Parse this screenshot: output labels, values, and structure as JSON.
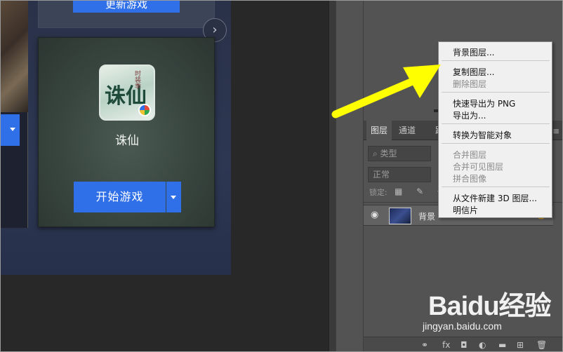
{
  "game_card": {
    "top_button_label": "更新游戏",
    "game_name": "诛仙",
    "icon_text": "诛仙",
    "icon_tag": "时装季",
    "play_button": "开始游戏",
    "next_arrow": "›"
  },
  "layers_panel": {
    "tabs": [
      "图层",
      "通道",
      "路"
    ],
    "active_tab": "图层",
    "filter_label": "类型",
    "blend_mode": "正常",
    "lock_label": "锁定:",
    "lock_icons": "▦ ✎ ✥",
    "layer": {
      "name": "背景",
      "eye": "◉",
      "lock_icon": "🔒"
    },
    "bottom_icons": [
      "⚭",
      "fx",
      "◘",
      "◐",
      "▬",
      "⊞",
      "🗑"
    ],
    "panel_menu_icon": "≡"
  },
  "context_menu": {
    "items": [
      {
        "label": "背景图层...",
        "enabled": true
      },
      {
        "label": "复制图层...",
        "enabled": true
      },
      {
        "label": "删除图层",
        "enabled": false
      },
      {
        "label": "快速导出为 PNG",
        "enabled": true
      },
      {
        "label": "导出为...",
        "enabled": true
      },
      {
        "label": "转换为智能对象",
        "enabled": true
      },
      {
        "label": "合并图层",
        "enabled": false
      },
      {
        "label": "合并可见图层",
        "enabled": false
      },
      {
        "label": "拼合图像",
        "enabled": false
      },
      {
        "label": "从文件新建 3D 图层...",
        "enabled": true
      },
      {
        "label": "明信片",
        "enabled": true
      }
    ]
  },
  "watermark": {
    "logo": "Baidu经验",
    "url": "jingyan.baidu.com"
  },
  "colors": {
    "accent_blue": "#2f6fe8",
    "arrow_yellow": "#ffff00",
    "panel_bg": "#535353"
  }
}
